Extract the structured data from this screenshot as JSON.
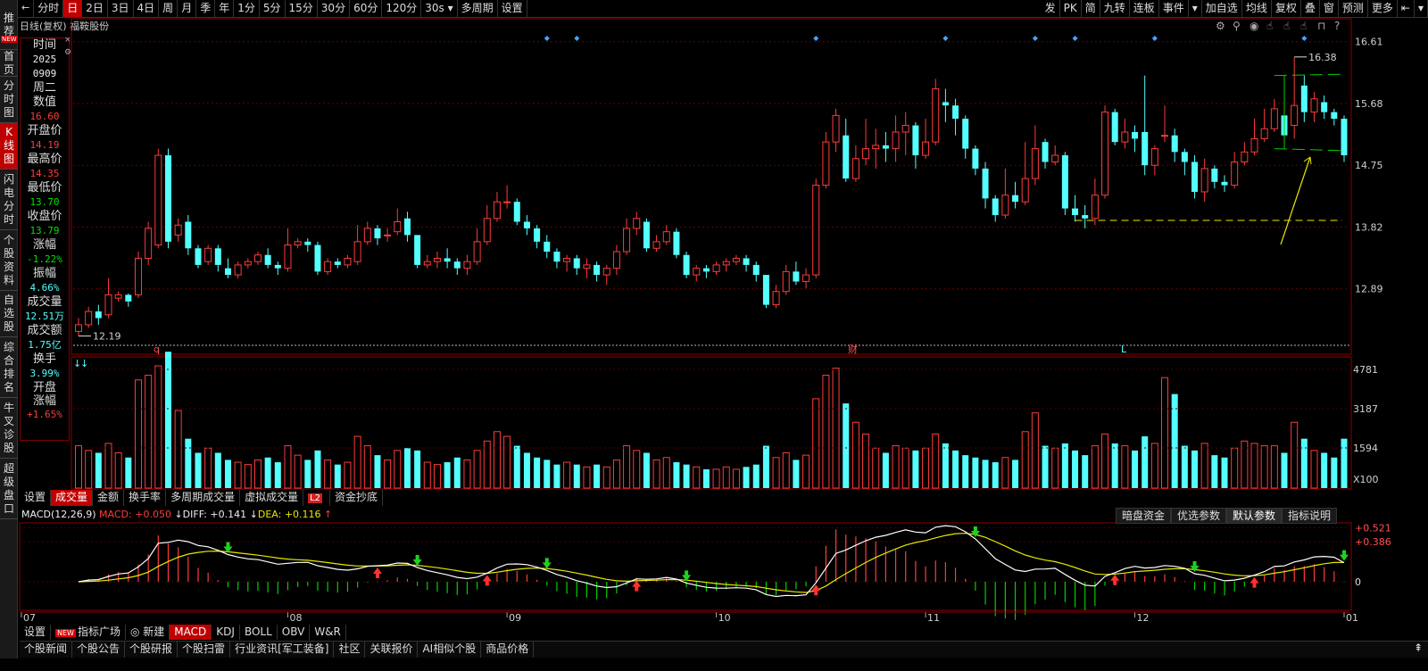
{
  "sidebar": {
    "items": [
      {
        "label": "推荐",
        "active": false
      },
      {
        "label": "首页",
        "active": false
      },
      {
        "label": "分时图",
        "active": false
      },
      {
        "label": "K线图",
        "active": true
      },
      {
        "label": "闪电分时",
        "active": false
      },
      {
        "label": "个股资料",
        "active": false
      },
      {
        "label": "自选股",
        "active": false
      },
      {
        "label": "综合排名",
        "active": false
      },
      {
        "label": "牛叉诊股",
        "active": false
      },
      {
        "label": "超级盘口",
        "active": false
      }
    ],
    "new_tag": "NEW"
  },
  "topbar": {
    "back": "←",
    "tabs": [
      "分时",
      "日",
      "2日",
      "3日",
      "4日",
      "周",
      "月",
      "季",
      "年",
      "1分",
      "5分",
      "15分",
      "30分",
      "60分",
      "120分",
      "30s ▾",
      "多周期",
      "设置"
    ],
    "active": "日",
    "right": [
      "发",
      "PK",
      "简",
      "九转",
      "连板",
      "事件",
      "▾",
      "加自选",
      "均线",
      "复权",
      "叠",
      "窗",
      "预测",
      "更多",
      "⇤",
      "▾"
    ]
  },
  "chart_title": "日线(复权) 福鞍股份",
  "info": {
    "fields": [
      {
        "label": "时间",
        "value": "2025",
        "color": "white"
      },
      {
        "label": "",
        "value": "0909",
        "color": "white"
      },
      {
        "label": "",
        "value": "周二",
        "color": "white",
        "big": true
      },
      {
        "label": "数值",
        "value": "16.60",
        "color": "red"
      },
      {
        "label": "开盘价",
        "value": "14.19",
        "color": "red"
      },
      {
        "label": "最高价",
        "value": "14.35",
        "color": "red"
      },
      {
        "label": "最低价",
        "value": "13.70",
        "color": "green"
      },
      {
        "label": "收盘价",
        "value": "13.79",
        "color": "green"
      },
      {
        "label": "涨幅",
        "value": "-1.22%",
        "color": "green"
      },
      {
        "label": "振幅",
        "value": "4.66%",
        "color": "cyan"
      },
      {
        "label": "成交量",
        "value": "12.51万",
        "color": "cyan"
      },
      {
        "label": "成交额",
        "value": "1.75亿",
        "color": "cyan"
      },
      {
        "label": "换手",
        "value": "3.99%",
        "color": "cyan"
      },
      {
        "label": "开盘涨幅",
        "value": "+1.65%",
        "color": "red"
      }
    ]
  },
  "price_axis": [
    "16.61",
    "15.68",
    "14.75",
    "13.82",
    "12.89"
  ],
  "price_markers": {
    "high": "16.38",
    "low": "12.19"
  },
  "event_markers": [
    "q",
    "财",
    "L"
  ],
  "volume_axis": [
    "4781",
    "3187",
    "1594",
    "X100"
  ],
  "volume_tabs": [
    "设置",
    "成交量",
    "金额",
    "换手率",
    "多周期成交量",
    "虚拟成交量",
    "L2",
    "资金抄底"
  ],
  "volume_tab_active": "成交量",
  "macd": {
    "name": "MACD(12,26,9)",
    "macd_label": "MACD:",
    "macd_value": "+0.050",
    "diff_label": "DIFF:",
    "diff_value": "+0.141",
    "dea_label": "DEA:",
    "dea_value": "+0.116",
    "axis": [
      "+0.521",
      "+0.386",
      "0"
    ],
    "buttons": [
      "暗盘资金",
      "优选参数",
      "默认参数",
      "指标说明"
    ],
    "active_button": "默认参数"
  },
  "date_axis": [
    "07",
    "08",
    "09",
    "10",
    "11",
    "12",
    "01"
  ],
  "indicator_tabs": [
    "设置",
    "指标广场",
    "新建",
    "MACD",
    "KDJ",
    "BOLL",
    "OBV",
    "W&R"
  ],
  "indicator_active": "MACD",
  "bottom_tabs": [
    "个股新闻",
    "个股公告",
    "个股研报",
    "个股扫雷",
    "行业资讯[军工装备]",
    "社区",
    "关联报价",
    "AI相似个股",
    "商品价格"
  ],
  "bottom_right": "⇞",
  "colors": {
    "up": "#ff3b3b",
    "down": "#54ffff",
    "dea": "#e8e800",
    "diff": "#ffffff"
  },
  "chart_data": {
    "type": "candlestick",
    "title": "日线(复权) 福鞍股份",
    "ylim": [
      12.0,
      16.7
    ],
    "x_months": [
      "07",
      "08",
      "09",
      "10",
      "11",
      "12",
      "01"
    ],
    "candles": [
      [
        12.25,
        12.35,
        12.18,
        12.45,
        1.8
      ],
      [
        12.35,
        12.55,
        12.3,
        12.62,
        1.6
      ],
      [
        12.55,
        12.45,
        12.35,
        12.65,
        1.5
      ],
      [
        12.5,
        12.8,
        12.45,
        13.05,
        1.9
      ],
      [
        12.75,
        12.8,
        12.7,
        12.85,
        1.5
      ],
      [
        12.8,
        12.7,
        12.62,
        12.82,
        1.3
      ],
      [
        12.8,
        13.35,
        12.75,
        13.45,
        4.6
      ],
      [
        13.35,
        13.8,
        13.25,
        13.9,
        4.8
      ],
      [
        13.55,
        14.9,
        13.5,
        15.0,
        5.2
      ],
      [
        14.9,
        13.6,
        13.5,
        15.0,
        5.8
      ],
      [
        13.7,
        13.85,
        13.6,
        13.95,
        3.3
      ],
      [
        13.9,
        13.5,
        13.4,
        14.0,
        2.1
      ],
      [
        13.5,
        13.25,
        13.2,
        13.55,
        1.5
      ],
      [
        13.3,
        13.5,
        13.25,
        13.55,
        1.7
      ],
      [
        13.5,
        13.25,
        13.15,
        13.55,
        1.5
      ],
      [
        13.2,
        13.1,
        13.05,
        13.35,
        1.2
      ],
      [
        13.1,
        13.25,
        13.05,
        13.3,
        1.1
      ],
      [
        13.25,
        13.3,
        13.2,
        13.35,
        1.0
      ],
      [
        13.3,
        13.4,
        13.25,
        13.45,
        1.2
      ],
      [
        13.4,
        13.25,
        13.2,
        13.5,
        1.3
      ],
      [
        13.25,
        13.2,
        13.1,
        13.3,
        1.1
      ],
      [
        13.2,
        13.55,
        13.15,
        13.8,
        1.8
      ],
      [
        13.55,
        13.6,
        13.5,
        13.65,
        1.4
      ],
      [
        13.6,
        13.55,
        13.45,
        13.65,
        1.2
      ],
      [
        13.55,
        13.15,
        13.1,
        13.6,
        1.6
      ],
      [
        13.15,
        13.3,
        13.1,
        13.35,
        1.2
      ],
      [
        13.3,
        13.25,
        13.2,
        13.35,
        1.0
      ],
      [
        13.25,
        13.35,
        13.2,
        13.4,
        1.1
      ],
      [
        13.3,
        13.6,
        13.25,
        13.85,
        2.2
      ],
      [
        13.6,
        13.8,
        13.55,
        13.9,
        1.8
      ],
      [
        13.8,
        13.65,
        13.55,
        13.85,
        1.4
      ],
      [
        13.7,
        13.7,
        13.6,
        13.8,
        1.2
      ],
      [
        13.75,
        13.9,
        13.7,
        14.1,
        1.6
      ],
      [
        13.95,
        13.7,
        13.6,
        14.05,
        1.7
      ],
      [
        13.7,
        13.25,
        13.2,
        13.7,
        1.6
      ],
      [
        13.25,
        13.3,
        13.2,
        13.4,
        1.1
      ],
      [
        13.3,
        13.35,
        13.2,
        13.45,
        1.0
      ],
      [
        13.35,
        13.3,
        13.2,
        13.5,
        1.1
      ],
      [
        13.3,
        13.2,
        13.1,
        13.35,
        1.3
      ],
      [
        13.2,
        13.3,
        13.1,
        13.4,
        1.2
      ],
      [
        13.3,
        13.6,
        13.25,
        13.8,
        1.6
      ],
      [
        13.6,
        13.95,
        13.55,
        14.15,
        2.0
      ],
      [
        13.95,
        14.2,
        13.9,
        14.35,
        2.4
      ],
      [
        14.2,
        14.2,
        14.1,
        14.45,
        2.2
      ],
      [
        14.2,
        13.9,
        13.85,
        14.25,
        1.8
      ],
      [
        13.9,
        13.8,
        13.7,
        14.0,
        1.5
      ],
      [
        13.8,
        13.6,
        13.5,
        13.85,
        1.3
      ],
      [
        13.6,
        13.45,
        13.35,
        13.7,
        1.2
      ],
      [
        13.45,
        13.3,
        13.2,
        13.5,
        1.0
      ],
      [
        13.3,
        13.35,
        13.15,
        13.4,
        1.1
      ],
      [
        13.35,
        13.2,
        13.1,
        13.4,
        1.0
      ],
      [
        13.2,
        13.25,
        13.05,
        13.35,
        0.9
      ],
      [
        13.25,
        13.1,
        13.0,
        13.3,
        1.0
      ],
      [
        13.1,
        13.2,
        12.95,
        13.25,
        0.9
      ],
      [
        13.2,
        13.45,
        13.1,
        13.55,
        1.2
      ],
      [
        13.45,
        13.8,
        13.4,
        13.95,
        1.8
      ],
      [
        13.8,
        13.95,
        13.7,
        14.05,
        1.6
      ],
      [
        13.9,
        13.5,
        13.45,
        13.95,
        1.5
      ],
      [
        13.5,
        13.6,
        13.45,
        13.7,
        1.2
      ],
      [
        13.6,
        13.75,
        13.55,
        13.85,
        1.3
      ],
      [
        13.75,
        13.4,
        13.35,
        13.8,
        1.1
      ],
      [
        13.4,
        13.1,
        13.05,
        13.45,
        1.0
      ],
      [
        13.1,
        13.2,
        13.0,
        13.25,
        0.9
      ],
      [
        13.2,
        13.15,
        13.05,
        13.25,
        0.8
      ],
      [
        13.15,
        13.25,
        13.1,
        13.3,
        0.8
      ],
      [
        13.25,
        13.3,
        13.15,
        13.35,
        0.9
      ],
      [
        13.3,
        13.35,
        13.25,
        13.4,
        0.8
      ],
      [
        13.35,
        13.25,
        13.15,
        13.4,
        0.9
      ],
      [
        13.25,
        13.1,
        13.0,
        13.3,
        1.0
      ],
      [
        13.1,
        12.65,
        12.6,
        13.1,
        1.8
      ],
      [
        12.65,
        12.85,
        12.6,
        12.95,
        1.3
      ],
      [
        12.85,
        13.15,
        12.8,
        13.25,
        1.5
      ],
      [
        13.15,
        13.0,
        12.95,
        13.3,
        1.2
      ],
      [
        13.0,
        13.1,
        12.9,
        13.2,
        1.4
      ],
      [
        13.1,
        14.45,
        13.05,
        14.55,
        3.8
      ],
      [
        14.45,
        15.1,
        14.4,
        15.25,
        4.8
      ],
      [
        15.1,
        15.5,
        14.95,
        15.6,
        5.1
      ],
      [
        15.2,
        14.55,
        14.5,
        15.45,
        3.6
      ],
      [
        14.55,
        14.85,
        14.5,
        15.05,
        2.8
      ],
      [
        14.85,
        15.0,
        14.75,
        15.45,
        2.3
      ],
      [
        15.0,
        15.05,
        14.7,
        15.3,
        1.7
      ],
      [
        15.05,
        15.0,
        14.8,
        15.25,
        1.5
      ],
      [
        15.0,
        15.25,
        14.8,
        15.5,
        1.8
      ],
      [
        15.25,
        15.35,
        14.9,
        15.55,
        1.7
      ],
      [
        15.35,
        14.9,
        14.7,
        15.4,
        1.6
      ],
      [
        14.9,
        15.1,
        14.85,
        15.45,
        1.7
      ],
      [
        15.1,
        15.9,
        15.05,
        16.05,
        2.3
      ],
      [
        15.7,
        15.65,
        15.4,
        15.9,
        1.9
      ],
      [
        15.65,
        15.45,
        15.2,
        15.75,
        1.6
      ],
      [
        15.45,
        15.0,
        14.85,
        15.5,
        1.4
      ],
      [
        15.0,
        14.7,
        14.6,
        15.05,
        1.3
      ],
      [
        14.7,
        14.25,
        14.1,
        14.8,
        1.2
      ],
      [
        14.25,
        14.0,
        13.9,
        14.3,
        1.1
      ],
      [
        14.0,
        14.3,
        13.95,
        14.7,
        1.3
      ],
      [
        14.3,
        14.2,
        14.1,
        14.5,
        1.2
      ],
      [
        14.2,
        14.55,
        14.15,
        15.1,
        2.4
      ],
      [
        14.55,
        15.0,
        14.45,
        15.35,
        3.2
      ],
      [
        15.1,
        14.8,
        14.7,
        15.15,
        1.8
      ],
      [
        14.8,
        14.9,
        14.75,
        15.05,
        1.7
      ],
      [
        14.9,
        14.1,
        14.0,
        14.95,
        1.9
      ],
      [
        14.1,
        14.0,
        13.9,
        14.3,
        1.6
      ],
      [
        14.0,
        13.95,
        13.8,
        14.15,
        1.4
      ],
      [
        13.95,
        14.3,
        13.85,
        14.55,
        1.8
      ],
      [
        14.3,
        15.55,
        14.25,
        15.65,
        2.3
      ],
      [
        15.55,
        15.1,
        15.05,
        15.6,
        1.9
      ],
      [
        15.1,
        15.25,
        15.0,
        15.45,
        1.8
      ],
      [
        15.25,
        15.15,
        14.95,
        15.35,
        1.6
      ],
      [
        15.25,
        14.75,
        14.6,
        16.1,
        2.2
      ],
      [
        14.75,
        15.0,
        14.6,
        15.05,
        1.9
      ],
      [
        15.2,
        15.2,
        15.1,
        15.65,
        4.7
      ],
      [
        15.2,
        14.95,
        14.8,
        15.3,
        4.0
      ],
      [
        14.95,
        14.8,
        14.6,
        15.0,
        1.8
      ],
      [
        14.8,
        14.35,
        14.25,
        14.9,
        1.6
      ],
      [
        14.35,
        14.7,
        14.2,
        14.85,
        1.9
      ],
      [
        14.7,
        14.5,
        14.4,
        14.75,
        1.4
      ],
      [
        14.5,
        14.45,
        14.35,
        14.6,
        1.3
      ],
      [
        14.45,
        14.8,
        14.4,
        14.95,
        1.7
      ],
      [
        14.8,
        14.95,
        14.75,
        15.1,
        2.0
      ],
      [
        14.95,
        15.15,
        14.9,
        15.45,
        1.9
      ],
      [
        15.15,
        15.3,
        15.1,
        15.6,
        1.8
      ],
      [
        15.3,
        15.6,
        15.25,
        15.75,
        1.8
      ],
      [
        15.5,
        15.2,
        15.05,
        15.55,
        1.5
      ],
      [
        15.35,
        15.65,
        15.15,
        16.38,
        2.8
      ],
      [
        15.95,
        15.55,
        15.4,
        16.1,
        2.1
      ],
      [
        15.55,
        15.75,
        15.4,
        15.85,
        1.6
      ],
      [
        15.7,
        15.55,
        15.45,
        15.8,
        1.5
      ],
      [
        15.55,
        15.45,
        15.35,
        15.6,
        1.3
      ],
      [
        15.45,
        14.9,
        14.8,
        15.5,
        2.1
      ]
    ]
  }
}
